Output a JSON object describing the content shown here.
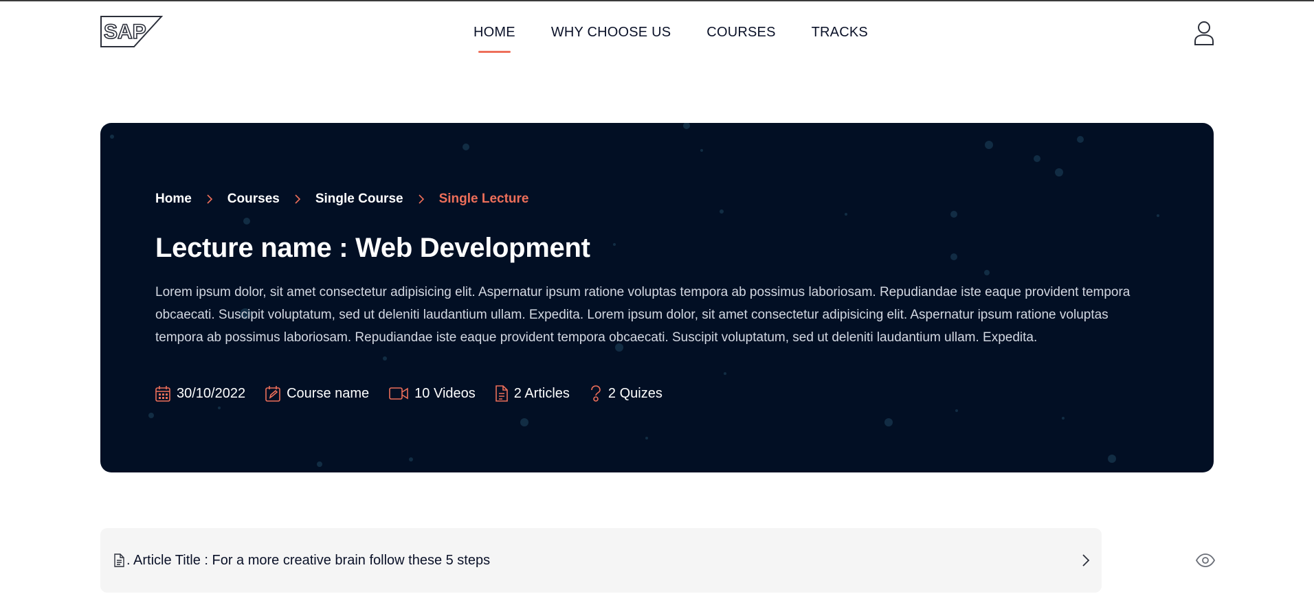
{
  "header": {
    "logo_text": "SAP",
    "nav": [
      {
        "label": "HOME",
        "active": true
      },
      {
        "label": "WHY CHOOSE US",
        "active": false
      },
      {
        "label": "COURSES",
        "active": false
      },
      {
        "label": "TRACKS",
        "active": false
      }
    ],
    "user_icon": "user-icon"
  },
  "hero": {
    "breadcrumb": [
      "Home",
      "Courses",
      "Single Course",
      "Single Lecture"
    ],
    "title": "Lecture name : Web Development",
    "description": "Lorem ipsum dolor, sit amet consectetur adipisicing elit. Aspernatur ipsum ratione voluptas tempora ab possimus laboriosam. Repudiandae iste eaque provident tempora obcaecati. Suscipit voluptatum, sed ut deleniti laudantium ullam. Expedita. Lorem ipsum dolor, sit amet consectetur adipisicing elit. Aspernatur ipsum ratione voluptas tempora ab possimus laboriosam. Repudiandae iste eaque provident tempora obcaecati. Suscipit voluptatum, sed ut deleniti laudantium ullam. Expedita.",
    "meta": {
      "date": "30/10/2022",
      "course": "Course name",
      "videos": "10 Videos",
      "articles": "2 Articles",
      "quizzes": "2 Quizes"
    }
  },
  "article": {
    "title": ". Article Title : For a more creative brain follow these 5 steps"
  },
  "colors": {
    "accent": "#ee6f5a",
    "hero_bg": "#020f24",
    "text_dark": "#0a1128",
    "row_bg": "#f5f5f5"
  }
}
